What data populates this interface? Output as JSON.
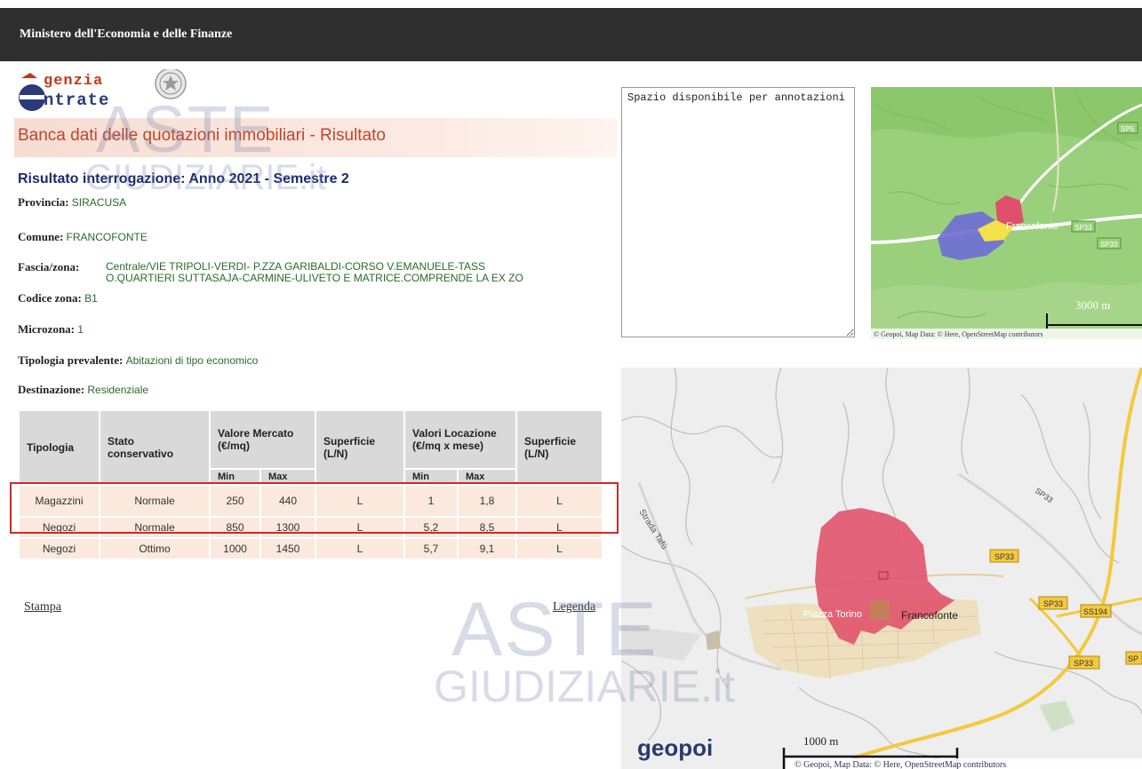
{
  "header": {
    "title": "Ministero dell'Economia e delle Finanze"
  },
  "logo": {
    "line1": "genzia",
    "line2": "ntrate"
  },
  "banner": {
    "title": "Banca dati delle quotazioni immobiliari - Risultato"
  },
  "result": {
    "heading": "Risultato interrogazione: Anno 2021 - Semestre 2",
    "provincia_label": "Provincia:",
    "provincia_value": "SIRACUSA",
    "comune_label": "Comune:",
    "comune_value": "FRANCOFONTE",
    "fascia_label": "Fascia/zona:",
    "fascia_line1": "Centrale/VIE TRIPOLI-VERDI- P.ZZA GARIBALDI-CORSO V.EMANUELE-TASS",
    "fascia_line2": "O.QUARTIERI SUTTASAJA-CARMINE-ULIVETO E MATRICE.COMPRENDE LA EX ZO",
    "codice_label": "Codice zona:",
    "codice_value": "B1",
    "microzona_label": "Microzona:",
    "microzona_value": "1",
    "tipologia_label": "Tipologia prevalente:",
    "tipologia_value": "Abitazioni di tipo economico",
    "destinazione_label": "Destinazione:",
    "destinazione_value": "Residenziale"
  },
  "table": {
    "headers": {
      "tipologia": "Tipologia",
      "stato": "Stato conservativo",
      "valore": "Valore Mercato (€/mq)",
      "superficie1": "Superficie (L/N)",
      "locazione": "Valori Locazione (€/mq x mese)",
      "superficie2": "Superficie (L/N)",
      "min": "Min",
      "max": "Max"
    },
    "rows": [
      {
        "tipologia": "Magazzini",
        "stato": "Normale",
        "vm_min": "250",
        "vm_max": "440",
        "sup1": "L",
        "loc_min": "1",
        "loc_max": "1,8",
        "sup2": "L"
      },
      {
        "tipologia": "Negozi",
        "stato": "Normale",
        "vm_min": "850",
        "vm_max": "1300",
        "sup1": "L",
        "loc_min": "5,2",
        "loc_max": "8,5",
        "sup2": "L"
      },
      {
        "tipologia": "Negozi",
        "stato": "Ottimo",
        "vm_min": "1000",
        "vm_max": "1450",
        "sup1": "L",
        "loc_min": "5,7",
        "loc_max": "9,1",
        "sup2": "L"
      }
    ]
  },
  "links": {
    "stampa": "Stampa",
    "legenda": "Legenda"
  },
  "notes": {
    "placeholder": "Spazio disponibile per annotazioni"
  },
  "map_small": {
    "town_label": "Francofonte",
    "roads": [
      "SP33",
      "SP33",
      "SP5"
    ],
    "scale": "3000 m",
    "attribution": "© Geopoi, Map Data: © Here, OpenStreetMap contributors"
  },
  "map_large": {
    "labels": {
      "strada": "Strada Tafù",
      "piazza": "Piazza Torino",
      "town": "Francofonte"
    },
    "roads": [
      "SP33",
      "SP33",
      "SP33",
      "SS194",
      "SP33",
      "SP"
    ],
    "scale": "1000 m",
    "brand": "geopoi",
    "attribution": "© Geopoi, Map Data: © Here, OpenStreetMap contributors"
  },
  "watermark": {
    "line1": "ASTE",
    "line2": "GIUDIZIARIE.it"
  },
  "colors": {
    "topbar": "#2f2f2f",
    "zone_red": "#e0506a",
    "road_yellow": "#f3c93e",
    "map_green": "#9ad07c",
    "value_green": "#2a6a2a"
  }
}
